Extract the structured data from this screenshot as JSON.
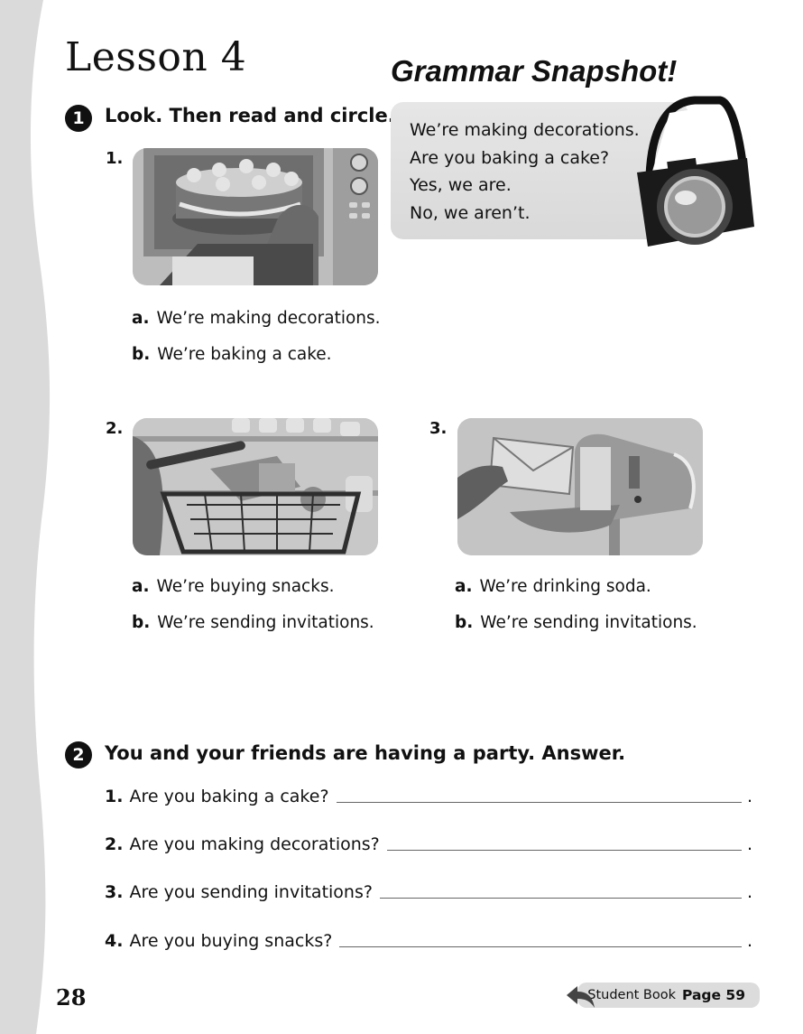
{
  "header": {
    "lesson_title": "Lesson 4",
    "snapshot_title": "Grammar Snapshot!"
  },
  "grammar_snapshot": {
    "lines": [
      "We’re making decorations.",
      "Are you baking a cake?",
      "Yes, we are.",
      "No, we aren’t."
    ],
    "icon": "camera-icon"
  },
  "exercise1": {
    "number": "1",
    "instruction": "Look. Then read and circle.",
    "items": [
      {
        "number": "1.",
        "image": "cake-in-oven-image",
        "options": [
          {
            "letter": "a.",
            "text": "We’re making decorations."
          },
          {
            "letter": "b.",
            "text": "We’re baking a cake."
          }
        ]
      },
      {
        "number": "2.",
        "image": "shopping-basket-image",
        "options": [
          {
            "letter": "a.",
            "text": "We’re buying snacks."
          },
          {
            "letter": "b.",
            "text": "We’re sending invitations."
          }
        ]
      },
      {
        "number": "3.",
        "image": "mailbox-envelope-image",
        "options": [
          {
            "letter": "a.",
            "text": "We’re drinking soda."
          },
          {
            "letter": "b.",
            "text": "We’re sending invitations."
          }
        ]
      }
    ]
  },
  "exercise2": {
    "number": "2",
    "instruction": "You and your friends are having a party. Answer.",
    "questions": [
      {
        "number": "1.",
        "text": "Are you baking a cake?"
      },
      {
        "number": "2.",
        "text": "Are you making decorations?"
      },
      {
        "number": "3.",
        "text": "Are you sending invitations?"
      },
      {
        "number": "4.",
        "text": "Are you buying snacks?"
      }
    ],
    "line_end": "."
  },
  "footer": {
    "page_number": "28",
    "student_book_label": "Student Book",
    "page_ref": "Page 59",
    "icon": "return-arrow-icon"
  }
}
